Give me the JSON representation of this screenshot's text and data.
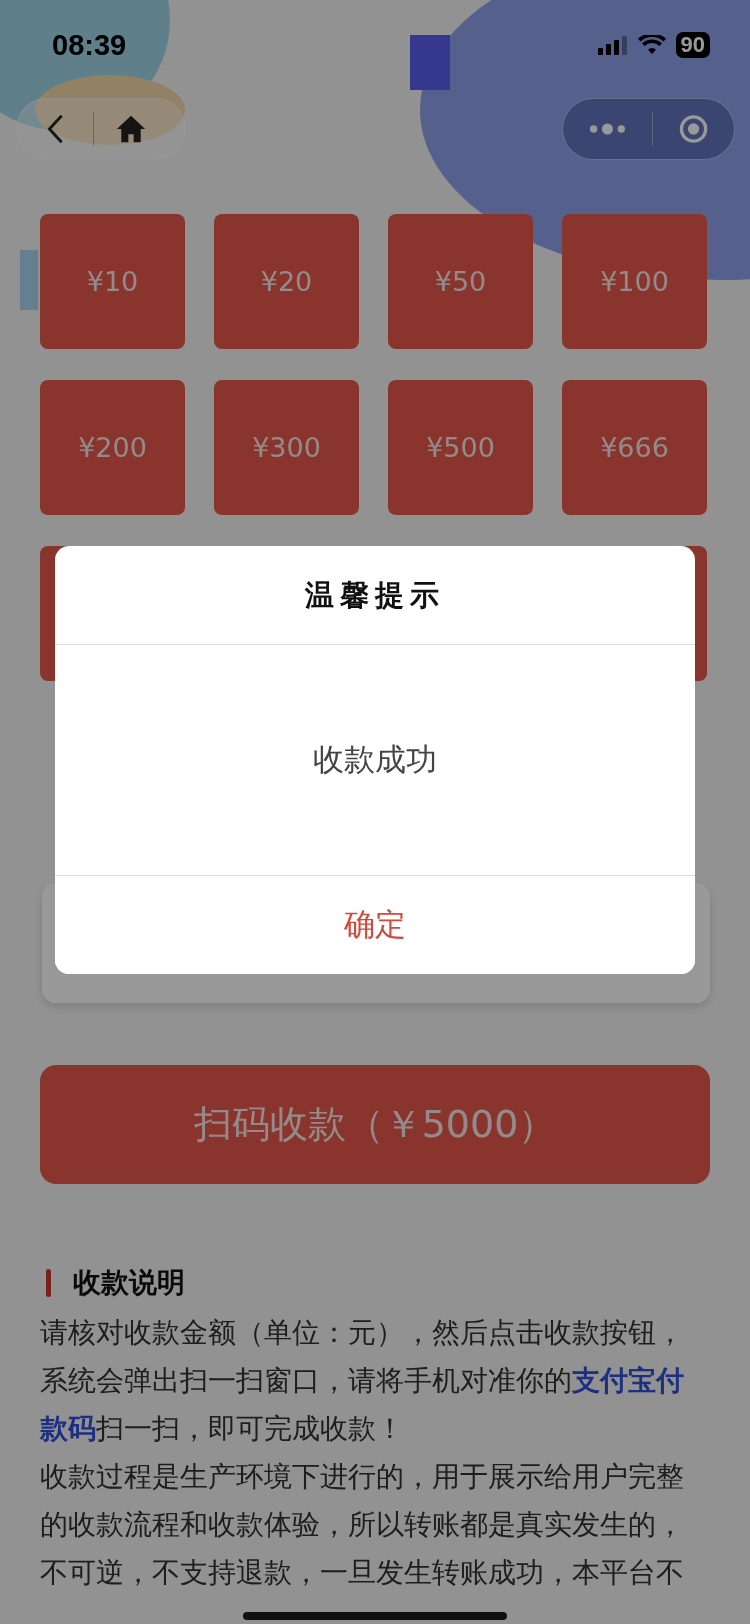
{
  "status_bar": {
    "time": "08:39",
    "battery": "90"
  },
  "amounts": [
    {
      "label": "¥10"
    },
    {
      "label": "¥20"
    },
    {
      "label": "¥50"
    },
    {
      "label": "¥100"
    },
    {
      "label": "¥200"
    },
    {
      "label": "¥300"
    },
    {
      "label": "¥500"
    },
    {
      "label": "¥666"
    }
  ],
  "pay_button": "扫码收款（￥5000）",
  "notes": {
    "title": "收款说明",
    "paragraphs": [
      "请核对收款金额（单位：元），然后点击收款按钮，系统会弹出扫一扫窗口，请将手机对准你的**支付宝付款码**扫一扫，即可完成收款！",
      "收款过程是生产环境下进行的，用于展示给用户完整的收款流程和收款体验，所以转账都是真实发生的，不可逆，不支持退款，一旦发生转账成功，本平台不"
    ]
  },
  "dialog": {
    "title": "温馨提示",
    "message": "收款成功",
    "confirm": "确定"
  }
}
